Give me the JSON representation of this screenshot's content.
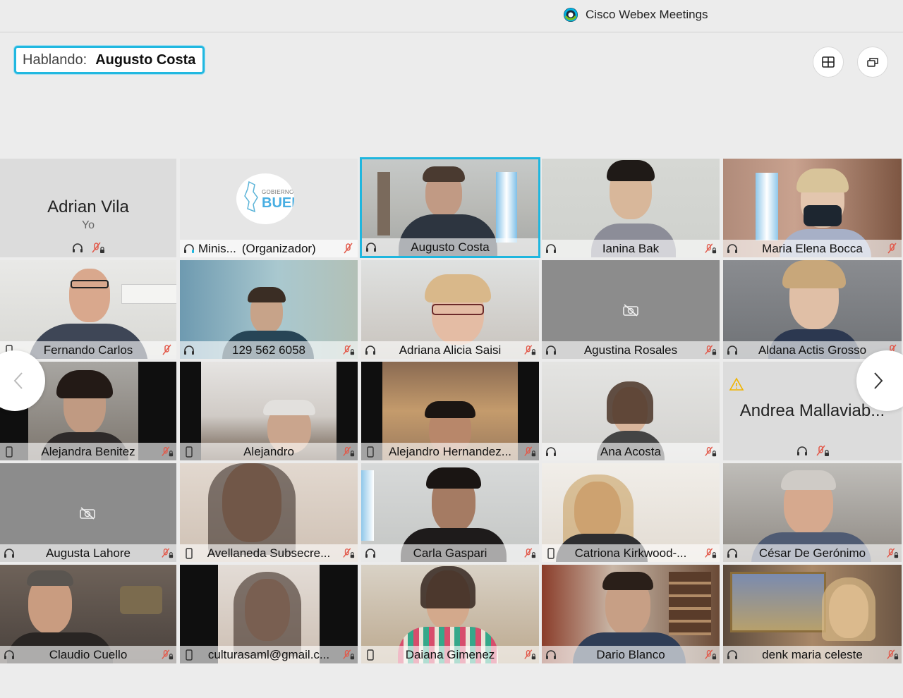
{
  "app": {
    "title": "Cisco Webex Meetings"
  },
  "speaking": {
    "label": "Hablando:",
    "name": "Augusto Costa"
  },
  "toolbar": {
    "grid_icon": "grid-layout-icon",
    "popout_icon": "popout-window-icon"
  },
  "colors": {
    "active_border": "#1fb6de",
    "muted_red": "#e2594a",
    "warning": "#f0b400"
  },
  "participants": [
    {
      "name": "Adrian Vila",
      "sub": "Yo"
    },
    {
      "name": "Minis...",
      "role": "(Organizador)"
    },
    {
      "name": "Augusto Costa"
    },
    {
      "name": "Ianina Bak"
    },
    {
      "name": "Maria Elena Bocca"
    },
    {
      "name": "Fernando Carlos"
    },
    {
      "name": "129 562 6058"
    },
    {
      "name": "Adriana Alicia Saisi"
    },
    {
      "name": "Agustina Rosales"
    },
    {
      "name": "Aldana Actis Grosso"
    },
    {
      "name": "Alejandra Benitez"
    },
    {
      "name": "Alejandro"
    },
    {
      "name": "Alejandro Hernandez..."
    },
    {
      "name": "Ana Acosta"
    },
    {
      "name": "Andrea Mallaviab..."
    },
    {
      "name": "Augusta Lahore"
    },
    {
      "name": "Avellaneda Subsecre..."
    },
    {
      "name": "Carla Gaspari"
    },
    {
      "name": "Catriona Kirkwood-..."
    },
    {
      "name": "César De Gerónimo"
    },
    {
      "name": "Claudio Cuello"
    },
    {
      "name": "culturasaml@gmail.c..."
    },
    {
      "name": "Daiana Gimenez"
    },
    {
      "name": "Dario Blanco"
    },
    {
      "name": "denk maria celeste"
    }
  ],
  "logo": {
    "line1": "GOBIERNO",
    "line2": "BUEN"
  }
}
